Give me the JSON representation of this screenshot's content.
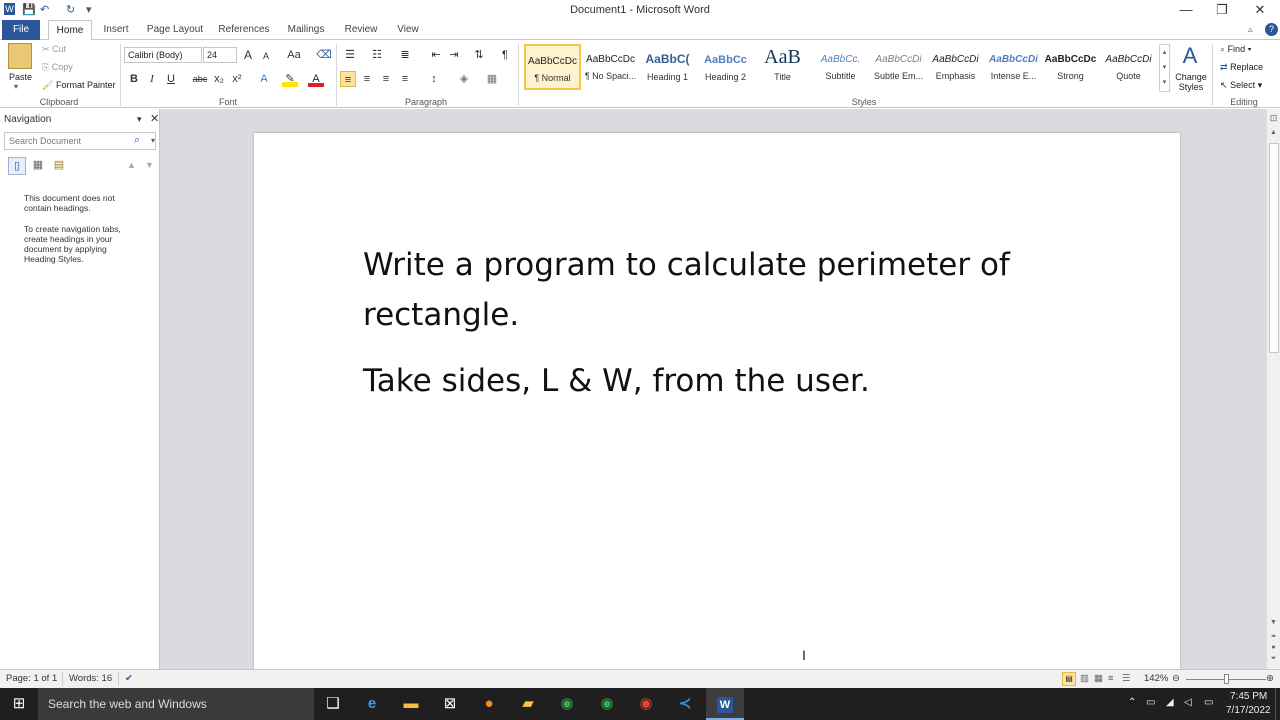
{
  "window": {
    "title": "Document1 - Microsoft Word",
    "minimize": "—",
    "restore": "❐",
    "close": "✕"
  },
  "tabs": [
    "File",
    "Home",
    "Insert",
    "Page Layout",
    "References",
    "Mailings",
    "Review",
    "View"
  ],
  "active_tab": "Home",
  "clipboard": {
    "paste": "Paste",
    "cut": "Cut",
    "copy": "Copy",
    "format_painter": "Format Painter",
    "label": "Clipboard"
  },
  "font": {
    "family": "Calibri (Body)",
    "size": "24",
    "label": "Font",
    "bold": "B",
    "italic": "I",
    "underline": "U",
    "strike": "abc",
    "subscript": "x₂",
    "superscript": "x²",
    "grow": "A",
    "shrink": "A",
    "change_case": "Aa"
  },
  "paragraph": {
    "label": "Paragraph"
  },
  "styles": {
    "label": "Styles",
    "items": [
      {
        "sample": "AaBbCcDc",
        "name": "¶ Normal"
      },
      {
        "sample": "AaBbCcDc",
        "name": "¶ No Spaci..."
      },
      {
        "sample": "AaBbC(",
        "name": "Heading 1"
      },
      {
        "sample": "AaBbCc",
        "name": "Heading 2"
      },
      {
        "sample": "AaB",
        "name": "Title"
      },
      {
        "sample": "AaBbCc.",
        "name": "Subtitle"
      },
      {
        "sample": "AaBbCcDi",
        "name": "Subtle Em..."
      },
      {
        "sample": "AaBbCcDi",
        "name": "Emphasis"
      },
      {
        "sample": "AaBbCcDi",
        "name": "Intense E..."
      },
      {
        "sample": "AaBbCcDc",
        "name": "Strong"
      },
      {
        "sample": "AaBbCcDi",
        "name": "Quote"
      }
    ],
    "change_styles": "Change Styles"
  },
  "editing": {
    "label": "Editing",
    "find": "Find",
    "replace": "Replace",
    "select": "Select"
  },
  "navigation": {
    "title": "Navigation",
    "search_placeholder": "Search Document",
    "msg1": "This document does not contain headings.",
    "msg2": "To create navigation tabs, create headings in your document by applying Heading Styles."
  },
  "document": {
    "line1": "Write a program to calculate perimeter of",
    "line2": "rectangle.",
    "line3": "Take sides, L & W, from the user."
  },
  "status": {
    "page": "Page: 1 of 1",
    "words": "Words: 16",
    "zoom": "142%"
  },
  "taskbar": {
    "search_placeholder": "Search the web and Windows",
    "time": "7:45 PM",
    "date": "7/17/2022"
  }
}
